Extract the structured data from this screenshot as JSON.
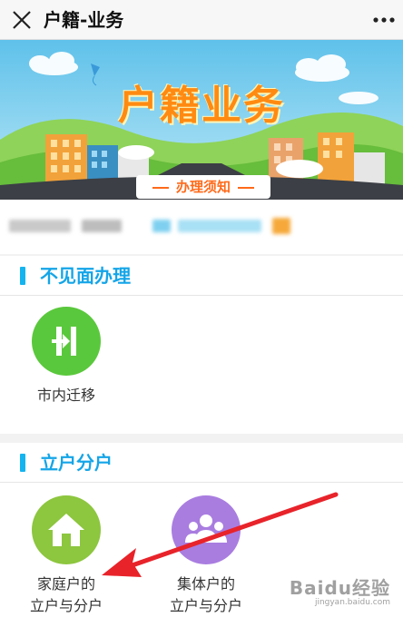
{
  "header": {
    "title": "户籍-业务",
    "close_icon": "close-icon",
    "more_icon": "more-dots-icon"
  },
  "banner": {
    "title": "户籍业务",
    "notice_label": "办理须知"
  },
  "sections": [
    {
      "title": "不见面办理",
      "items": [
        {
          "label": "市内迁移",
          "icon": "transfer-icon",
          "color": "#5ac83c"
        }
      ]
    },
    {
      "title": "立户分户",
      "items": [
        {
          "label": "家庭户的\n立户与分户",
          "icon": "house-icon",
          "color": "#8dc63f"
        },
        {
          "label": "集体户的\n立户与分户",
          "icon": "group-icon",
          "color": "#a97de0"
        }
      ]
    }
  ],
  "watermark": {
    "main": "Baidu经验",
    "sub": "jingyan.baidu.com"
  },
  "colors": {
    "accent": "#14a5e8",
    "banner_title": "#ff8a12",
    "annotation_arrow": "#e8232a"
  }
}
